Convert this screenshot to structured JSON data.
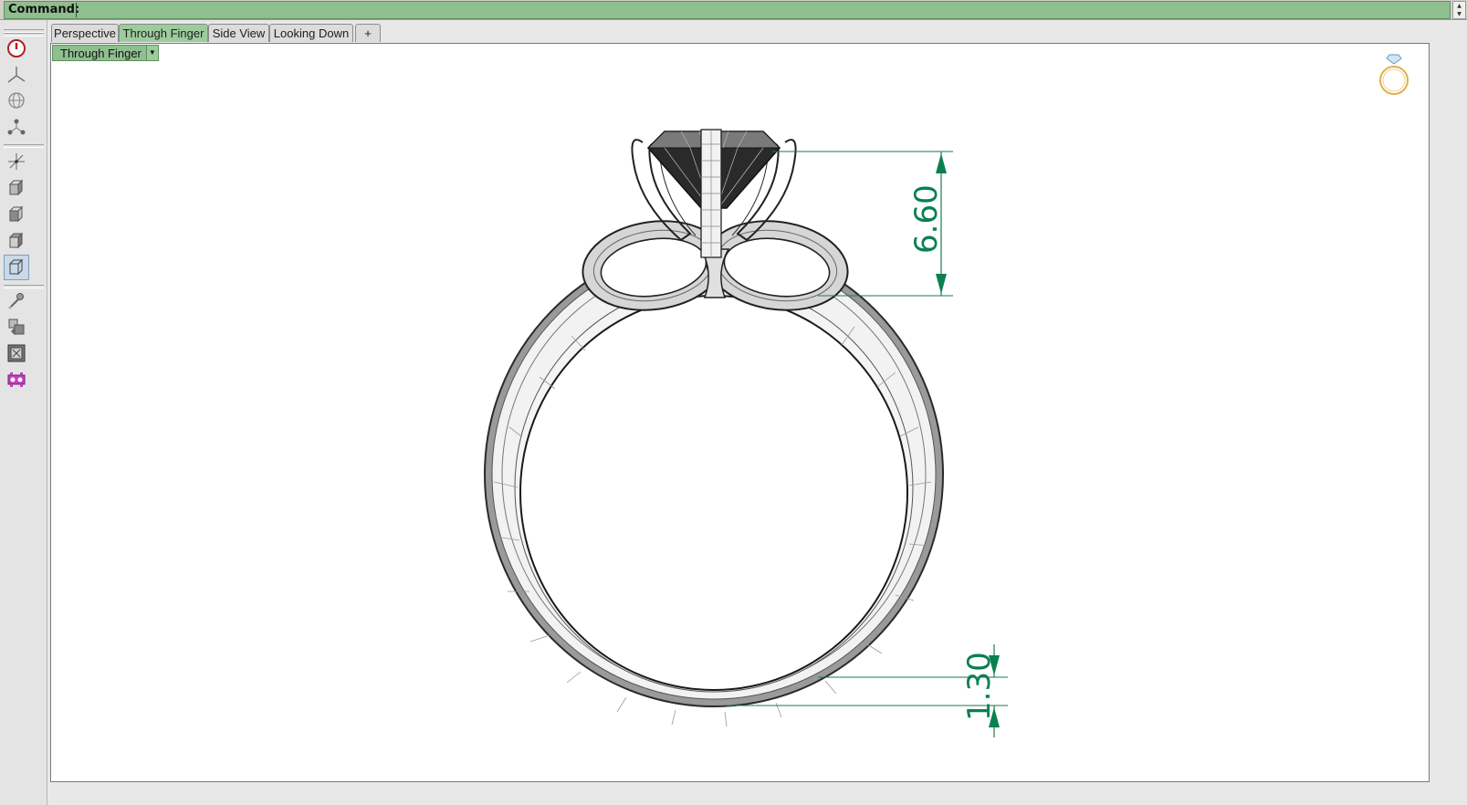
{
  "command_bar": {
    "label": "Command:",
    "value": ""
  },
  "toolbar": {
    "buttons": [
      {
        "name": "power-icon"
      },
      {
        "name": "tripod-icon"
      },
      {
        "name": "globe-icon"
      },
      {
        "name": "nodes-icon"
      },
      {
        "name": "axes-icon"
      },
      {
        "name": "cube-shaded-icon"
      },
      {
        "name": "cube-front-icon"
      },
      {
        "name": "cube-side-icon"
      },
      {
        "name": "cube-wire-icon",
        "active": true
      },
      {
        "name": "eyedropper-icon"
      },
      {
        "name": "layers-icon"
      },
      {
        "name": "frame-icon"
      },
      {
        "name": "gear-purple-icon"
      }
    ]
  },
  "tabs": [
    {
      "label": "Perspective",
      "active": false
    },
    {
      "label": "Through Finger",
      "active": true
    },
    {
      "label": "Side View",
      "active": false
    },
    {
      "label": "Looking Down",
      "active": false
    },
    {
      "label": "+",
      "icon": "add-tab-icon"
    }
  ],
  "viewport": {
    "label": "Through Finger",
    "dimensions": [
      {
        "value": "6.60"
      },
      {
        "value": "1.30"
      }
    ],
    "thumbnail": "ring-thumbnail-icon"
  },
  "colors": {
    "accent_green": "#8fbf8f",
    "dimension_green": "#0a8050",
    "stone_dark": "#2a2a2a"
  }
}
